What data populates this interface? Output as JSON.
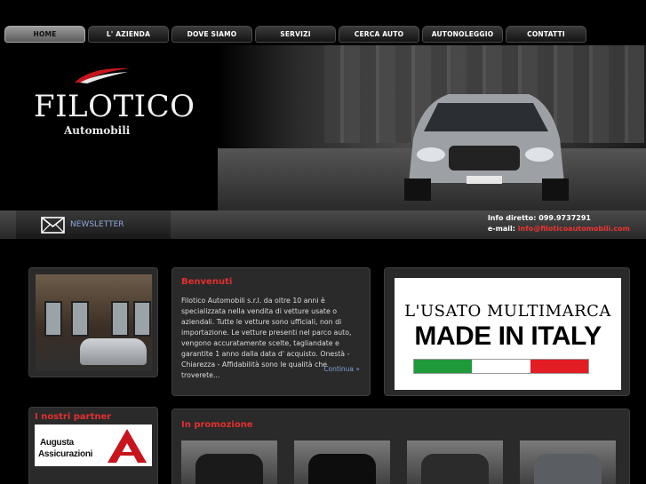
{
  "nav": {
    "items": [
      {
        "label": "HOME",
        "active": true
      },
      {
        "label": "L' AZIENDA"
      },
      {
        "label": "DOVE SIAMO"
      },
      {
        "label": "SERVIZI"
      },
      {
        "label": "CERCA AUTO"
      },
      {
        "label": "AUTONOLEGGIO"
      },
      {
        "label": "CONTATTI"
      }
    ]
  },
  "header": {
    "logo_title": "FILOTICO",
    "logo_subtitle": "Automobili"
  },
  "bar": {
    "newsletter_label": "NEWSLETTER",
    "info_label": "Info diretto:",
    "phone": "099.9737291",
    "email_label": "e-mail:",
    "email": "info@filoticoautomobili.com"
  },
  "welcome": {
    "title": "Benvenuti",
    "text": "Filotico Automobili s.r.l. da oltre 10 anni è specializzata nella vendita di vetture usate o aziendali. Tutte le vetture sono ufficiali, non di importazione. Le vetture presenti nel parco auto, vengono accuratamente scelte, tagliandate e garantite 1 anno dalla data d' acquisto. Onestà - Chiarezza - Affidabilità sono le qualità che troverete...",
    "more": "Continua »"
  },
  "banner": {
    "line1": "L'USATO MULTIMARCA",
    "line2": "MADE IN ITALY",
    "flag_colors": [
      "#1f9a3a",
      "#ffffff",
      "#e21d24"
    ]
  },
  "partner": {
    "title": "I nostri partner",
    "name_line1": "Augusta",
    "name_line2": "Assicurazioni"
  },
  "promo": {
    "title": "In promozione"
  },
  "colors": {
    "accent_red": "#e03030",
    "link_blue": "#7fa0d8"
  }
}
